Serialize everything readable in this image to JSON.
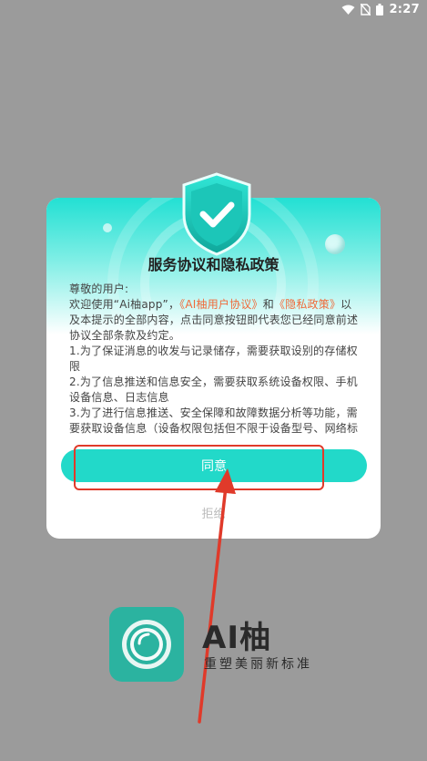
{
  "status_bar": {
    "time": "2:27"
  },
  "dialog": {
    "title": "服务协议和隐私政策",
    "greeting": "尊敬的用户:",
    "intro_prefix": "欢迎使用“Ai柚app”，",
    "user_agreement_link": "《AI柚用户协议》",
    "intro_and": "和",
    "privacy_link": "《隐私政策》",
    "intro_suffix": "以及本提示的全部内容，点击同意按钮即代表您已经同意前述协议全部条款及约定。",
    "item1": "1.为了保证消息的收发与记录储存，需要获取设别的存储权限",
    "item2": "2.为了信息推送和信息安全，需要获取系统设备权限、手机设备信息、日志信息",
    "item3": "3.为了进行信息推送、安全保障和故障数据分析等功能，需要获取设备信息（设备权限包括但不限于设备型号、网络标",
    "agree_label": "同意",
    "reject_label": "拒绝"
  },
  "brand": {
    "name": "AI柚",
    "slogan": "重塑美丽新标准"
  },
  "colors": {
    "accent": "#22d9c9",
    "link": "#f06a3a",
    "annotation": "#e03a2a",
    "logo_bg": "#2bb3a0"
  }
}
